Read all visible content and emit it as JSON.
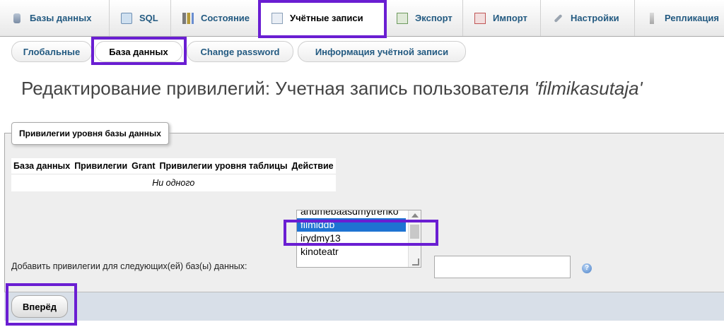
{
  "top_tabs": [
    {
      "label": "Базы данных",
      "icon": "database-icon"
    },
    {
      "label": "SQL",
      "icon": "sql-icon"
    },
    {
      "label": "Состояние",
      "icon": "status-icon"
    },
    {
      "label": "Учётные записи",
      "icon": "users-icon"
    },
    {
      "label": "Экспорт",
      "icon": "export-icon"
    },
    {
      "label": "Импорт",
      "icon": "import-icon"
    },
    {
      "label": "Настройки",
      "icon": "wrench-icon"
    },
    {
      "label": "Репликация",
      "icon": "replication-icon"
    }
  ],
  "sub_tabs": [
    {
      "label": "Глобальные"
    },
    {
      "label": "База данных"
    },
    {
      "label": "Change password"
    },
    {
      "label": "Информация учётной записи"
    }
  ],
  "page_title": {
    "prefix": "Редактирование привилегий: Учетная запись пользователя ",
    "user": "'filmikasutaja'"
  },
  "fieldset": {
    "legend": "Привилегии уровня базы данных",
    "table": {
      "headers": [
        "База данных",
        "Привилегии",
        "Grant",
        "Привилегии уровня таблицы",
        "Действие"
      ],
      "empty_text": "Ни одного"
    },
    "add_label": "Добавить привилегии для следующих(ей) баз(ы) данных:",
    "db_options": [
      "andmebaasdmytrenko",
      "filmiddb",
      "irydmy13",
      "kinoteatr"
    ],
    "selected_db": "filmiddb",
    "text_value": ""
  },
  "go_button": "Вперёд",
  "colors": {
    "link": "#235a81",
    "highlight": "#6a1ed2",
    "selection": "#1e73d2"
  }
}
